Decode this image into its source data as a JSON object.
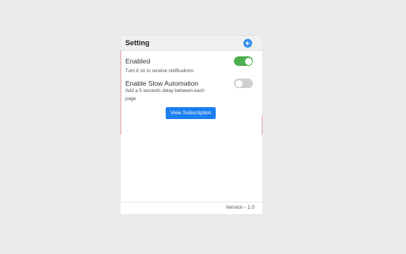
{
  "header": {
    "title": "Setting",
    "back_icon": "arrow-left-circle-icon"
  },
  "settings": [
    {
      "label": "Enabled",
      "description": "Turn it on to receive notifications",
      "enabled": true
    },
    {
      "label": "Enable Slow Automation",
      "description_line1": "Add a 5 seconds delay between each",
      "description_line2": "page",
      "enabled": false
    }
  ],
  "subscription_button": "View Subscription",
  "footer": {
    "version": "Version - 1.0"
  },
  "colors": {
    "accent": "#1a7ff0",
    "toggle_on": "#4cae4f",
    "toggle_off": "#cfcfcf",
    "back_button": "#2f8ef0"
  }
}
